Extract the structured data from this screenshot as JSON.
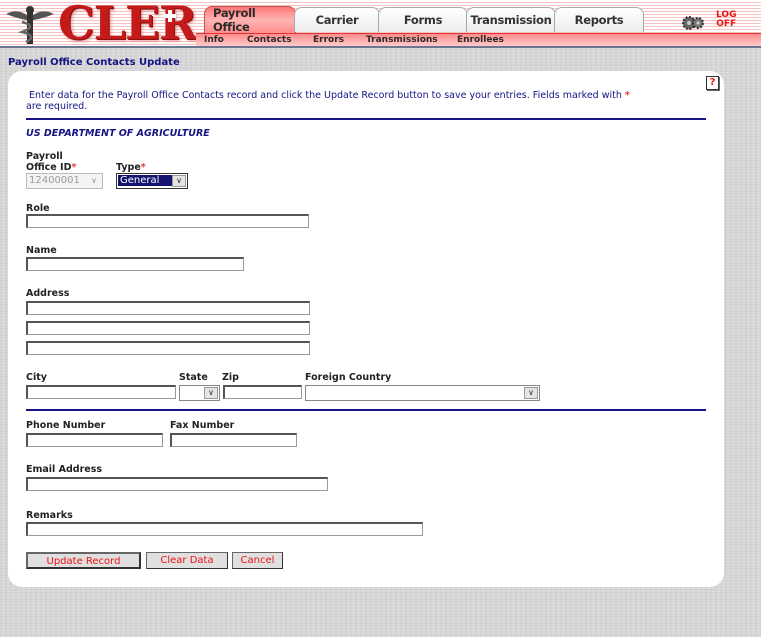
{
  "header": {
    "logo_text": "CLER",
    "tabs": [
      {
        "label": "Payroll Office",
        "active": true
      },
      {
        "label": "Carrier",
        "active": false
      },
      {
        "label": "Forms",
        "active": false
      },
      {
        "label": "Transmission",
        "active": false
      },
      {
        "label": "Reports",
        "active": false
      }
    ],
    "subnav": [
      "Info",
      "Contacts",
      "Errors",
      "Transmissions",
      "Enrollees"
    ],
    "logoff_line1": "LOG",
    "logoff_line2": "OFF"
  },
  "page": {
    "title": "Payroll Office Contacts Update",
    "help_label": "?",
    "intro_line1": "Enter data for the Payroll Office Contacts record and click the Update Record button to save your entries.  Fields marked with ",
    "intro_asterisk": "*",
    "intro_line2": "are required.",
    "organization": "US DEPARTMENT OF AGRICULTURE"
  },
  "form": {
    "payroll_office_id_label1": "Payroll",
    "payroll_office_id_label2": "Office ID",
    "payroll_office_id_value": "12400001",
    "type_label": "Type",
    "type_value": "General",
    "required_mark": "*",
    "role_label": "Role",
    "role_value": "",
    "name_label": "Name",
    "name_value": "",
    "address_label": "Address",
    "address_values": [
      "",
      "",
      ""
    ],
    "city_label": "City",
    "city_value": "",
    "state_label": "State",
    "state_value": "",
    "zip_label": "Zip",
    "zip_value": "",
    "foreign_country_label": "Foreign Country",
    "foreign_country_value": "",
    "phone_label": "Phone Number",
    "phone_value": "",
    "fax_label": "Fax Number",
    "fax_value": "",
    "email_label": "Email Address",
    "email_value": "",
    "remarks_label": "Remarks",
    "remarks_value": ""
  },
  "buttons": {
    "update": "Update Record",
    "clear": "Clear Data",
    "cancel": "Cancel"
  },
  "colors": {
    "accent_red": "#e11111",
    "heading_navy": "#141484",
    "tab_active": "#ff8c8c"
  }
}
